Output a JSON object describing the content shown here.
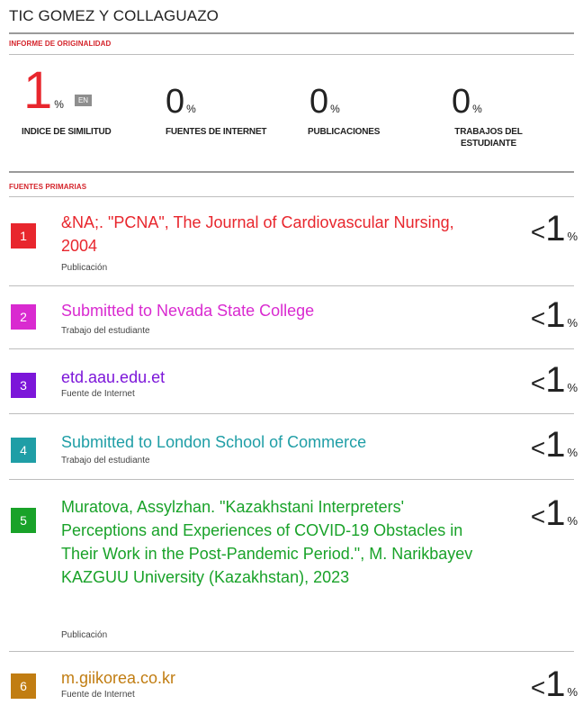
{
  "header": {
    "title": "TIC GOMEZ Y COLLAGUAZO"
  },
  "report": {
    "section_label": "INFORME DE ORIGINALIDAD",
    "stats": [
      {
        "value": "1",
        "suffix": "%",
        "label": "INDICE DE SIMILITUD",
        "badge": "EN"
      },
      {
        "value": "0",
        "suffix": "%",
        "label": "FUENTES DE INTERNET"
      },
      {
        "value": "0",
        "suffix": "%",
        "label": "PUBLICACIONES"
      },
      {
        "value": "0",
        "suffix": "%",
        "label": "TRABAJOS DEL ESTUDIANTE"
      }
    ]
  },
  "sources": {
    "section_label": "FUENTES PRIMARIAS",
    "items": [
      {
        "num": "1",
        "title": "&NA;. \"PCNA\", The Journal of Cardiovascular Nursing, 2004",
        "type": "Publicación",
        "lt": "<",
        "value": "1",
        "pct": "%",
        "color": "#e8262d"
      },
      {
        "num": "2",
        "title": "Submitted to Nevada State College",
        "type": "Trabajo del estudiante",
        "lt": "<",
        "value": "1",
        "pct": "%",
        "color": "#d92ad0"
      },
      {
        "num": "3",
        "title": "etd.aau.edu.et",
        "type": "Fuente de Internet",
        "lt": "<",
        "value": "1",
        "pct": "%",
        "color": "#7c16d9"
      },
      {
        "num": "4",
        "title": "Submitted to London School of Commerce",
        "type": "Trabajo del estudiante",
        "lt": "<",
        "value": "1",
        "pct": "%",
        "color": "#1f9ea6"
      },
      {
        "num": "5",
        "title": "Muratova, Assylzhan. \"Kazakhstani Interpreters' Perceptions and Experiences of COVID-19 Obstacles in Their Work in the Post-Pandemic Period.\", M. Narikbayev KAZGUU University (Kazakhstan), 2023",
        "type": "Publicación",
        "lt": "<",
        "value": "1",
        "pct": "%",
        "color": "#19a229"
      },
      {
        "num": "6",
        "title": "m.giikorea.co.kr",
        "type": "Fuente de Internet",
        "lt": "<",
        "value": "1",
        "pct": "%",
        "color": "#c17d12"
      }
    ]
  }
}
